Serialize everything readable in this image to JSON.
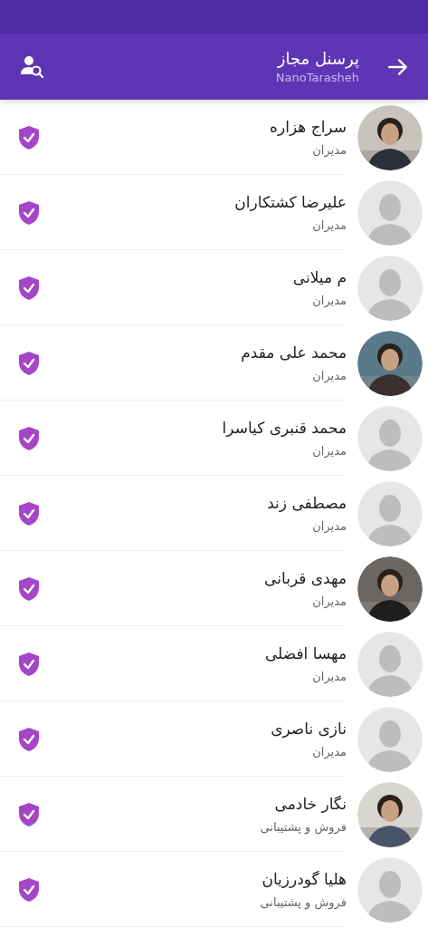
{
  "header": {
    "title": "پرسنل مجاز",
    "subtitle": "NanoTarasheh"
  },
  "people": [
    {
      "name": "سراج هزاره",
      "role": "مدیران",
      "verified": true
    },
    {
      "name": "علیرضا کشتکاران",
      "role": "مدیران",
      "kind": "placeholder",
      "verified": true
    },
    {
      "name": "م میلانی",
      "role": "مدیران",
      "kind": "placeholder",
      "verified": true
    },
    {
      "name": "محمد علی مقدم",
      "role": "مدیران",
      "verified": true
    },
    {
      "name": "محمد قنبری کیاسرا",
      "role": "مدیران",
      "kind": "placeholder",
      "verified": true
    },
    {
      "name": "مصطفی زند",
      "role": "مدیران",
      "kind": "placeholder",
      "verified": true
    },
    {
      "name": "مهدی قربانی",
      "role": "مدیران",
      "verified": true
    },
    {
      "name": "مهسا افضلی",
      "role": "مدیران",
      "kind": "placeholder",
      "verified": true
    },
    {
      "name": "نازی ناصری",
      "role": "مدیران",
      "kind": "placeholder",
      "verified": true
    },
    {
      "name": "نگار خادمی",
      "role": "فروش و پشتیبانی",
      "verified": true
    },
    {
      "name": "هلیا گودرزیان",
      "role": "فروش و پشتیبانی",
      "kind": "placeholder",
      "verified": true
    }
  ]
}
